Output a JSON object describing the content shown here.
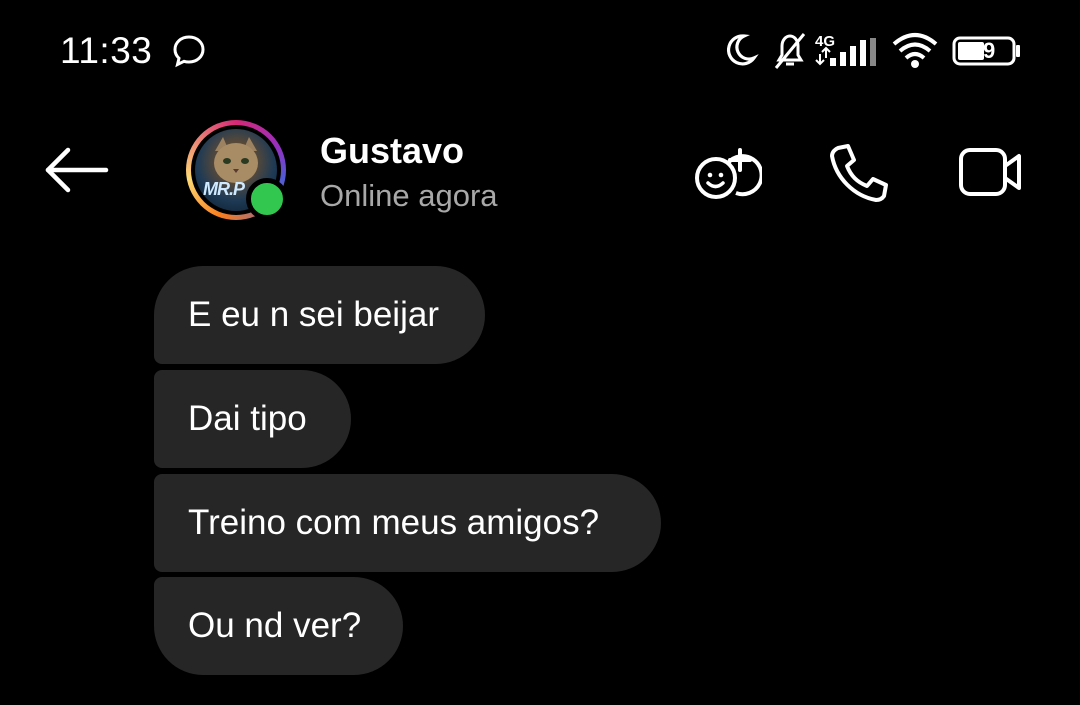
{
  "status_bar": {
    "time": "11:33",
    "network_type": "4G",
    "battery_level": "49",
    "icons": [
      "chat-bubble-icon",
      "moon-icon",
      "bell-off-icon",
      "signal-icon",
      "wifi-icon",
      "battery-icon"
    ]
  },
  "header": {
    "contact_name": "Gustavo",
    "contact_status": "Online agora",
    "avatar_text": "MR.P",
    "icons": [
      "back-arrow-icon",
      "add-friends-icon",
      "phone-icon",
      "video-camera-icon"
    ]
  },
  "messages": [
    {
      "text": "E eu n sei beijar"
    },
    {
      "text": "Dai tipo"
    },
    {
      "text": "Treino com meus amigos?"
    },
    {
      "text": "Ou nd ver?"
    }
  ],
  "colors": {
    "background": "#000000",
    "bubble": "#262626",
    "online": "#32c850",
    "secondary_text": "#a8a8a8"
  }
}
